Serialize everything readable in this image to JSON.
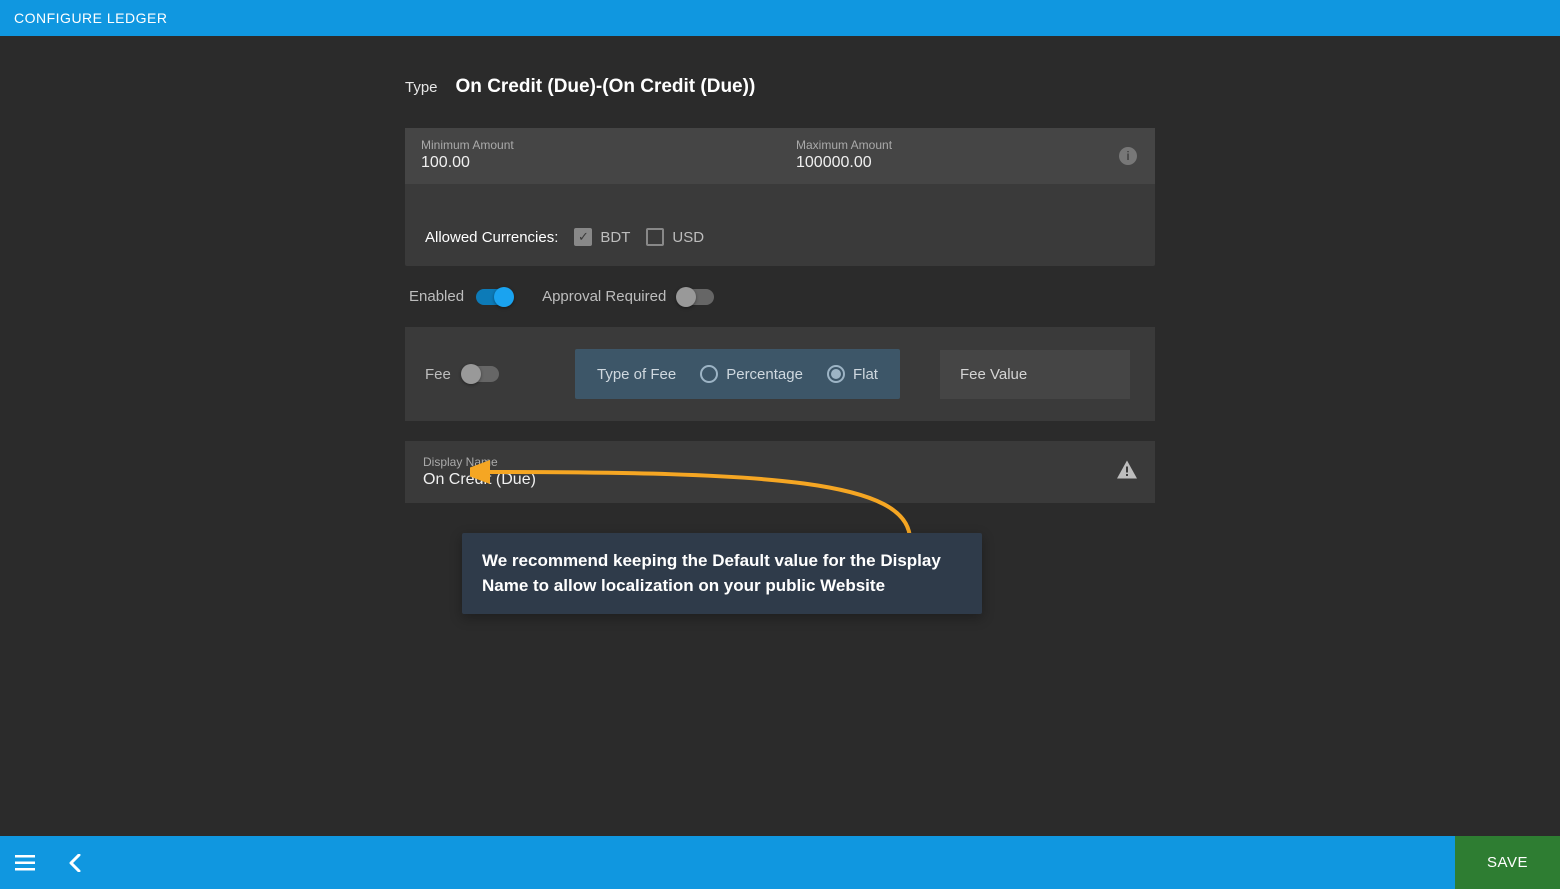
{
  "header": {
    "title": "CONFIGURE LEDGER"
  },
  "type": {
    "label": "Type",
    "value": "On Credit (Due)-(On Credit (Due))"
  },
  "amounts": {
    "min": {
      "label": "Minimum Amount",
      "value": "100.00"
    },
    "max": {
      "label": "Maximum Amount",
      "value": "100000.00"
    }
  },
  "currencies": {
    "label": "Allowed Currencies:",
    "options": [
      {
        "code": "BDT",
        "checked": true
      },
      {
        "code": "USD",
        "checked": false
      }
    ]
  },
  "toggles": {
    "enabled": {
      "label": "Enabled",
      "on": true
    },
    "approval": {
      "label": "Approval Required",
      "on": false
    }
  },
  "fee": {
    "label": "Fee",
    "on": false,
    "type_label": "Type of Fee",
    "percentage": "Percentage",
    "flat": "Flat",
    "selected": "flat",
    "value_label": "Fee Value"
  },
  "display": {
    "label": "Display Name",
    "value": "On Credit (Due)"
  },
  "callout": {
    "text": "We recommend keeping the Default value for the Display Name to allow localization on your public Website"
  },
  "footer": {
    "save": "SAVE"
  },
  "icons": {
    "info": "i",
    "menu": "☰",
    "back": "‹",
    "warn": "▲",
    "check": "✓"
  },
  "colors": {
    "accent": "#1097e0",
    "save": "#2e7d32",
    "callout_arrow": "#f5a623"
  }
}
